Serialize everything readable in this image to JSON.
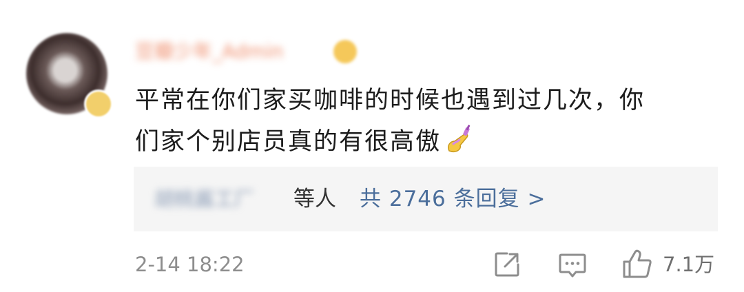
{
  "comment": {
    "username": "豆瓣少年_Admin",
    "text_line1": "平常在你们家买咖啡的时候也遇到过几次，你",
    "text_line2": "们家个别店员真的有很高傲",
    "emoji": "nail-polish"
  },
  "replies": {
    "names": "胡桃酱工厂",
    "etc_label": "等人",
    "total_label": "共 2746 条回复 >"
  },
  "footer": {
    "time": "2-14 18:22",
    "like_count": "7.1万"
  },
  "colors": {
    "link": "#4b6e9b",
    "meta": "#8d8d8d",
    "reply_bg": "#f5f5f5"
  }
}
